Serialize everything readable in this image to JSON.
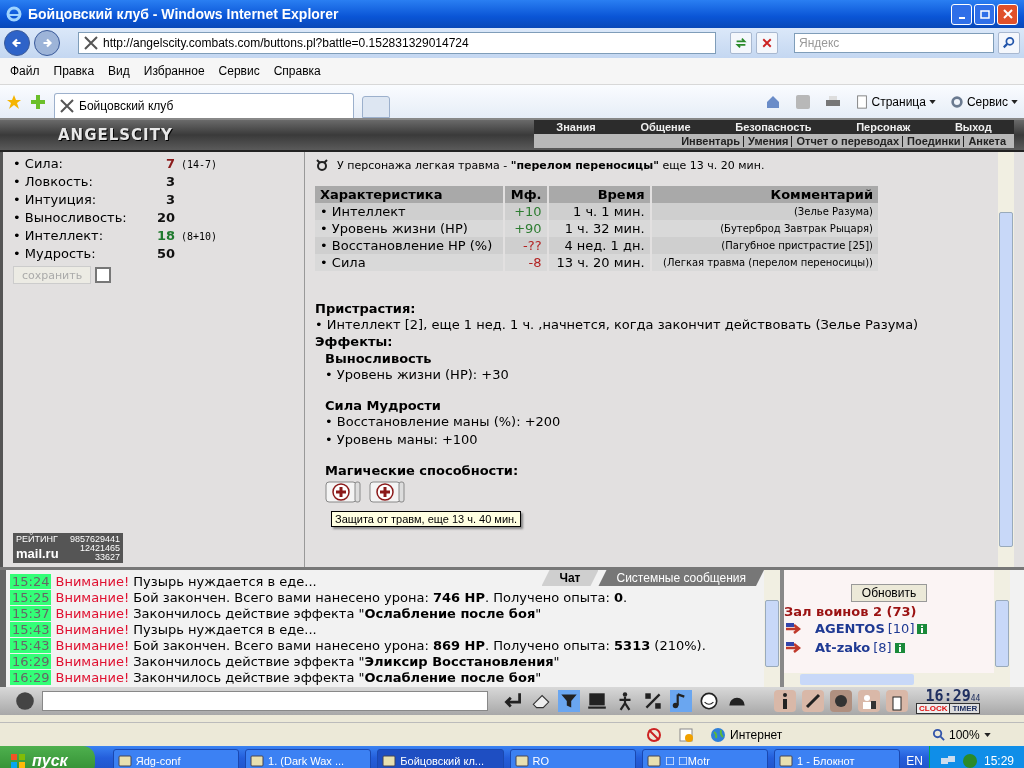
{
  "window": {
    "title": "Бойцовский клуб - Windows Internet Explorer"
  },
  "browser": {
    "address": "http://angelscity.combats.com/buttons.pl?battle=0.152831329014724",
    "search_placeholder": "Яндекс",
    "menu": [
      "Файл",
      "Правка",
      "Вид",
      "Избранное",
      "Сервис",
      "Справка"
    ],
    "tab": "Бойцовский клуб",
    "commands": [
      "Страница",
      "Сервис"
    ]
  },
  "game": {
    "logo": "ANGELSCITY",
    "nav_top": [
      "Знания",
      "Общение",
      "Безопасность",
      "Персонаж",
      "Выход"
    ],
    "nav_bottom": [
      "Инвентарь",
      "Умения",
      "Отчет о переводах",
      "Поединки",
      "Анкета"
    ]
  },
  "stats": [
    {
      "label": "• Сила:",
      "value": "7",
      "extra": "(14-7)",
      "color": "#8b1a1a"
    },
    {
      "label": "• Ловкость:",
      "value": "3",
      "color": "#111111"
    },
    {
      "label": "• Интуиция:",
      "value": "3",
      "color": "#111111"
    },
    {
      "label": "• Выносливость:",
      "value": "20",
      "color": "#111111"
    },
    {
      "label": "• Интеллект:",
      "value": "18",
      "extra": "(8+10)",
      "color": "#1f7a2e"
    },
    {
      "label": "• Мудрость:",
      "value": "50",
      "color": "#111111"
    }
  ],
  "save_button": {
    "label": "сохранить",
    "disabled": true
  },
  "save_checkbox": {
    "checked": false
  },
  "counter": {
    "title": "РЕЙТИНГ",
    "number": "9857629441",
    "brand": "mail.ru",
    "hits": "12421465",
    "hosts": "33627"
  },
  "injury": "У персонажа легкая травма - **\"перелом переносицы\"** еще 13 ч. 20 мин.",
  "table": {
    "columns": [
      "Характеристика",
      "Мф.",
      "Время",
      "Комментарий"
    ],
    "rows": [
      {
        "name": "• Интеллект",
        "mf": "+10",
        "time": "1 ч. 1 мин.",
        "comment": "(Зелье Разума)",
        "color": "#2e7d32"
      },
      {
        "name": "• Уровень жизни (HP)",
        "mf": "+90",
        "time": "1 ч. 32 мин.",
        "comment": "(Бутерброд Завтрак Рыцаря)",
        "color": "#2e7d32"
      },
      {
        "name": "• Восстановление HP (%)",
        "mf": "-??",
        "time": "4 нед. 1 дн.",
        "comment": "(Пагубное пристрастие [25])",
        "color": "#b22222"
      },
      {
        "name": "• Сила",
        "mf": "-8",
        "time": "13 ч. 20 мин.",
        "comment": "(Легкая травма (перелом переносицы))",
        "color": "#b22222"
      }
    ]
  },
  "addictions": {
    "title": "Пристрастия:",
    "items": [
      "• Интеллект [2], еще 1 нед. 1 ч. ,начнется, когда закончит действовать (Зелье Разума)"
    ]
  },
  "effects": {
    "title": "Эффекты:",
    "groups": [
      {
        "name": "Выносливость",
        "items": [
          "• Уровень жизни (HP): +30"
        ]
      },
      {
        "name": "Сила Мудрости",
        "items": [
          "• Восстановление маны (%): +200",
          "• Уровень маны: +100"
        ]
      }
    ]
  },
  "magic": {
    "title": "Магические способности:",
    "scrolls": [
      {
        "kind": "heal"
      },
      {
        "kind": "heal"
      }
    ],
    "tooltip": "Защита от травм, еще 13 ч. 40 мин."
  },
  "chat": {
    "tabs": [
      {
        "label": "Чат",
        "selected": true
      },
      {
        "label": "Системные сообщения",
        "selected": false
      }
    ],
    "messages": [
      {
        "time": "15:24",
        "alert": "Внимание!",
        "text": "Пузырь нуждается в еде..."
      },
      {
        "time": "15:25",
        "alert": "Внимание!",
        "text": "Бой закончен. Всего вами нанесено урона: **746 HP**. Получено опыта: **0**."
      },
      {
        "time": "15:37",
        "alert": "Внимание!",
        "text": "Закончилось действие эффекта \"**Ослабление после боя**\""
      },
      {
        "time": "15:43",
        "alert": "Внимание!",
        "text": "Пузырь нуждается в еде..."
      },
      {
        "time": "15:43",
        "alert": "Внимание!",
        "text": "Бой закончен. Всего вами нанесено урона: **869 HP**. Получено опыта: **5313** (210%)."
      },
      {
        "time": "16:29",
        "alert": "Внимание!",
        "text": "Закончилось действие эффекта \"**Эликсир Восстановления**\""
      },
      {
        "time": "16:29",
        "alert": "Внимание!",
        "text": "Закончилось действие эффекта \"**Ослабление после боя**\""
      }
    ]
  },
  "online": {
    "refresh": "Обновить",
    "room": "Зал воинов 2 (73)",
    "users": [
      {
        "name": "AGENTOS",
        "level": "[10]"
      },
      {
        "name": "At-zako",
        "level": "[8]"
      }
    ]
  },
  "clock": {
    "time": "16:29",
    "seconds": "44",
    "clock_label": "CLOCK",
    "timer_label": "TIMER"
  },
  "status_bar": {
    "zone": "Интернет",
    "zoom": "100%"
  },
  "taskbar": {
    "start": "пуск",
    "tasks": [
      {
        "label": "Яdg-conf",
        "selected": false
      },
      {
        "label": "1. (Dark Wax ...",
        "selected": false
      },
      {
        "label": "Бойцовский кл...",
        "selected": true
      },
      {
        "label": "RO",
        "selected": false
      },
      {
        "label": "☐ ☐Motr",
        "selected": false
      },
      {
        "label": "1 - Блокнот",
        "selected": false
      }
    ],
    "lang": "EN",
    "time": "15:29"
  }
}
